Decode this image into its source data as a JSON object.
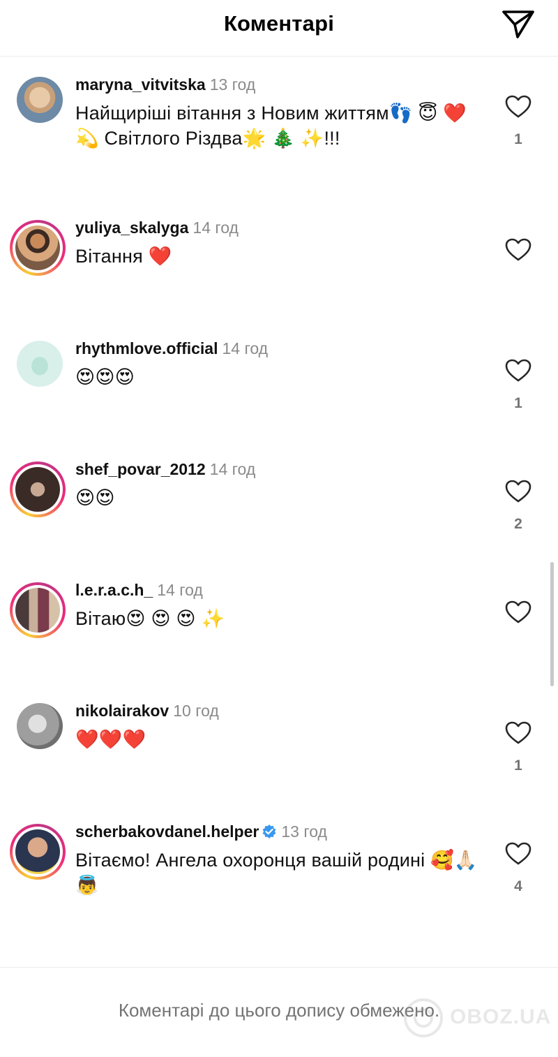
{
  "header": {
    "title": "Коментарі",
    "send_icon": "paper-plane-icon"
  },
  "comments": [
    {
      "username": "maryna_vitvitska",
      "time": "13 год",
      "text": "Найщиріші вітання з Новим життям👣 😇 ❤️ 💫 Світлого Різдва🌟 🎄 ✨!!!",
      "likes": "1",
      "story": false
    },
    {
      "username": "yuliya_skalyga",
      "time": "14 год",
      "text": "Вітання ❤️",
      "likes": "",
      "story": true
    },
    {
      "username": "rhythmlove.official",
      "time": "14 год",
      "text": "😍😍😍",
      "likes": "1",
      "story": false
    },
    {
      "username": "shef_povar_2012",
      "time": "14 год",
      "text": "😍😍",
      "likes": "2",
      "story": true
    },
    {
      "username": "l.e.r.a.c.h_",
      "time": "14 год",
      "text": "Вітаю😍 😍 😍 ✨",
      "likes": "",
      "story": true
    },
    {
      "username": "nikolairakov",
      "time": "10 год",
      "text": "❤️❤️❤️",
      "likes": "1",
      "story": false
    },
    {
      "username": "scherbakovdanel.helper",
      "time": "13 год",
      "text": "Вітаємо!  Ангела охоронця вашій родині 🥰🙏🏻 👼",
      "likes": "4",
      "story": true,
      "verified": true
    }
  ],
  "footer": {
    "text": "Коментарі до цього допису обмежено."
  },
  "watermark": {
    "text": "OBOZ.UA"
  },
  "colors": {
    "story_gradient": [
      "#f9ce34",
      "#ee2a7b",
      "#c13584"
    ],
    "verified": "#3897f0",
    "muted": "#8a8a8a"
  }
}
